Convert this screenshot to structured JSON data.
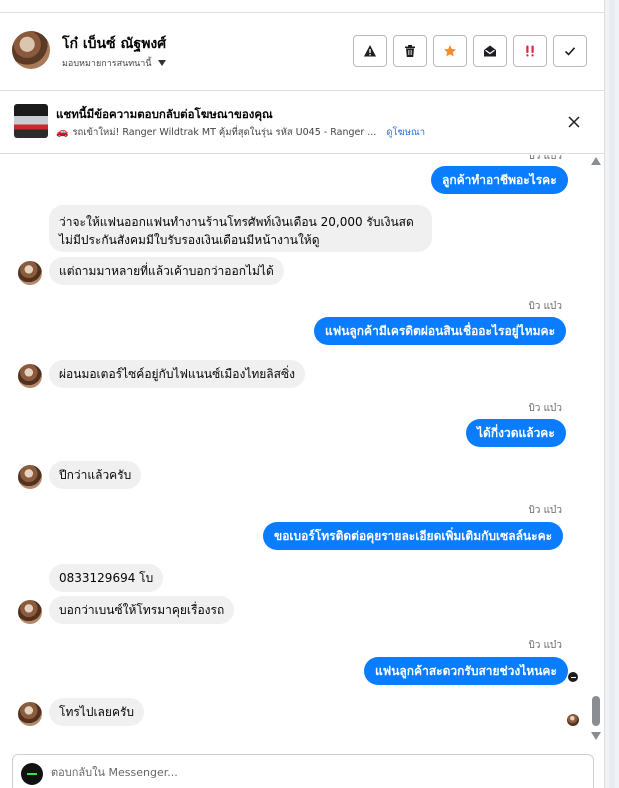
{
  "header": {
    "contact_name": "โก๋ เบ็นซ์ ณัฐพงศ์",
    "assign_label": "มอบหมายการสนทนานี้",
    "actions": [
      "warning-icon",
      "trash-icon",
      "star-icon",
      "envelope-open-icon",
      "double-exclamation-icon",
      "check-icon"
    ],
    "star_color": "#f28c28",
    "exclaim_color": "#e41e3f"
  },
  "ad_banner": {
    "title": "แชทนี้มีข้อความตอบกลับต่อโฆษณาของคุณ",
    "subtitle": "รถเข้าใหม่! Ranger Wildtrak MT คุ้มที่สุดในรุ่น รหัส U045 - Ranger ...",
    "link": "ดูโฆษณา"
  },
  "messages": {
    "m1": {
      "from": "page",
      "sender": "บิว แบ๋ว",
      "text": "ลูกค้าทำอาชีพอะไรคะ"
    },
    "m2": {
      "from": "contact",
      "line1": "ว่าจะให้แฟนออกแฟนทำงานร้านโทรศัพท์เงินเดือน 20,000 รับเงินสด",
      "line2": "ไม่มีประกันสังคมมีใบรับรองเงินเดือนมีหน้างานให้ดู"
    },
    "m3": {
      "from": "contact",
      "text": "แต่ถามมาหลายที่แล้วเค้าบอกว่าออกไม่ได้"
    },
    "m4": {
      "from": "page",
      "sender": "บิว แบ๋ว",
      "text": "แฟนลูกค้ามีเครดิตผ่อนสินเชื่ออะไรอยู่ไหมคะ"
    },
    "m5": {
      "from": "contact",
      "text": "ผ่อนมอเตอร์ไซค์อยู่กับไฟแนนซ์เมืองไทยลิสซิ่ง"
    },
    "m6": {
      "from": "page",
      "sender": "บิว แบ๋ว",
      "text": "ได้กี่งวดแล้วคะ"
    },
    "m7": {
      "from": "contact",
      "text": "ปีกว่าแล้วครับ"
    },
    "m8": {
      "from": "page",
      "sender": "บิว แบ๋ว",
      "text": "ขอเบอร์โทรติดต่อคุยรายละเอียดเพิ่มเติมกับเซลล์นะคะ"
    },
    "m9": {
      "from": "contact",
      "text": "0833129694 โบ"
    },
    "m10": {
      "from": "contact",
      "text": "บอกว่าเบนซ์ให้โทรมาคุยเรื่องรถ"
    },
    "m11": {
      "from": "page",
      "sender": "บิว แบ๋ว",
      "text": "แฟนลูกค้าสะดวกรับสายช่วงไหนคะ"
    },
    "m12": {
      "from": "contact",
      "text": "โทรไปเลยครับ"
    }
  },
  "composer": {
    "placeholder": "ตอบกลับใน Messenger..."
  },
  "colors": {
    "outgoing_bubble": "#0a7cff",
    "incoming_bubble": "#f0f0f0",
    "link": "#1877f2"
  }
}
